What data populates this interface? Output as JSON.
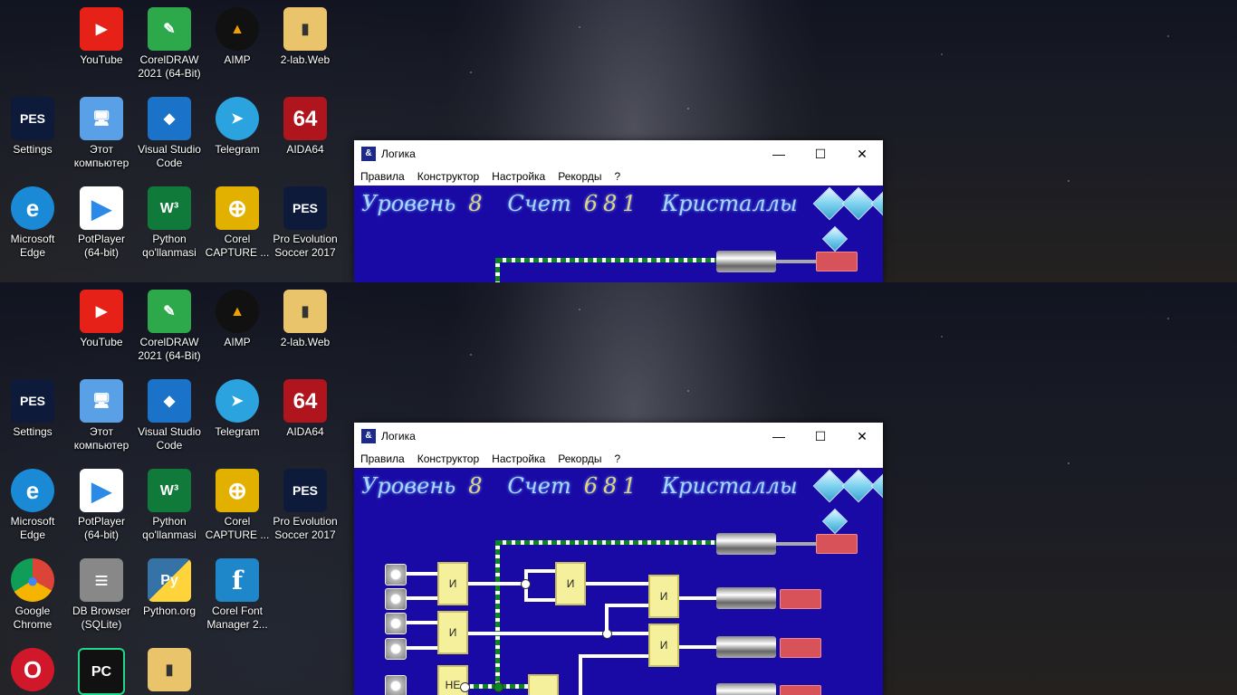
{
  "desktop": {
    "icons_row1": [
      {
        "id": "youtube",
        "label": "YouTube",
        "color": "#e62117",
        "glyph": "▶"
      },
      {
        "id": "coreldraw",
        "label": "CorelDRAW 2021 (64-Bit)",
        "color": "#2da84a",
        "glyph": "✎"
      },
      {
        "id": "aimp",
        "label": "AIMP",
        "color": "#f0a000",
        "glyph": "▲"
      },
      {
        "id": "2lab",
        "label": "2-lab.Web",
        "color": "#e9c46a",
        "glyph": "▮"
      }
    ],
    "icons_row2": [
      {
        "id": "pes-settings",
        "label": "Settings",
        "color": "#0d1a3a",
        "glyph": "PES"
      },
      {
        "id": "this-pc",
        "label": "Этот компьютер",
        "color": "#5aa0e6",
        "glyph": "🖥"
      },
      {
        "id": "vscode",
        "label": "Visual Studio Code",
        "color": "#1a73c8",
        "glyph": "◆"
      },
      {
        "id": "telegram",
        "label": "Telegram",
        "color": "#2aa3de",
        "glyph": "➤"
      },
      {
        "id": "aida64",
        "label": "AIDA64",
        "color": "#b0141c",
        "glyph": "64"
      }
    ],
    "icons_row3": [
      {
        "id": "edge",
        "label": "Microsoft Edge",
        "color": "#1b8ad6",
        "glyph": "e"
      },
      {
        "id": "potplayer",
        "label": "PotPlayer (64-bit)",
        "color": "#ffffff",
        "glyph": "▶"
      },
      {
        "id": "python-qo",
        "label": "Python qo'llanmasi",
        "color": "#0f7a3a",
        "glyph": "W³"
      },
      {
        "id": "corel-capture",
        "label": "Corel CAPTURE ...",
        "color": "#e2b100",
        "glyph": "⊕"
      },
      {
        "id": "pes2017",
        "label": "Pro Evolution Soccer 2017",
        "color": "#0d1a3a",
        "glyph": "PES"
      }
    ],
    "icons_row4": [
      {
        "id": "chrome",
        "label": "Google Chrome",
        "color": "#2e9b4a",
        "glyph": "●"
      },
      {
        "id": "db-browser",
        "label": "DB Browser (SQLite)",
        "color": "#888888",
        "glyph": "≡"
      },
      {
        "id": "python-org",
        "label": "Python.org",
        "color": "#3572a5",
        "glyph": "Py"
      },
      {
        "id": "corel-font",
        "label": "Corel Font Manager 2...",
        "color": "#1d87c9",
        "glyph": "f"
      }
    ],
    "icons_row5": [
      {
        "id": "opera",
        "label": "",
        "color": "#d0182a",
        "glyph": "O"
      },
      {
        "id": "pycharm",
        "label": "",
        "color": "#111111",
        "glyph": "PC"
      },
      {
        "id": "pes-file",
        "label": "",
        "color": "#e9c46a",
        "glyph": "▮"
      }
    ]
  },
  "window": {
    "title": "Логика",
    "app_icon": "logic-app-icon",
    "controls": {
      "minimize": "—",
      "maximize": "☐",
      "close": "✕"
    },
    "menu": [
      "Правила",
      "Конструктор",
      "Настройка",
      "Рекорды",
      "?"
    ]
  },
  "game": {
    "level_label": "Уровень",
    "level_value": "8",
    "score_label": "Счет",
    "score_value": "681",
    "crystals_label": "Кристаллы",
    "crystals_count": 4,
    "gates": {
      "and": "И",
      "not": "НЕ"
    }
  }
}
